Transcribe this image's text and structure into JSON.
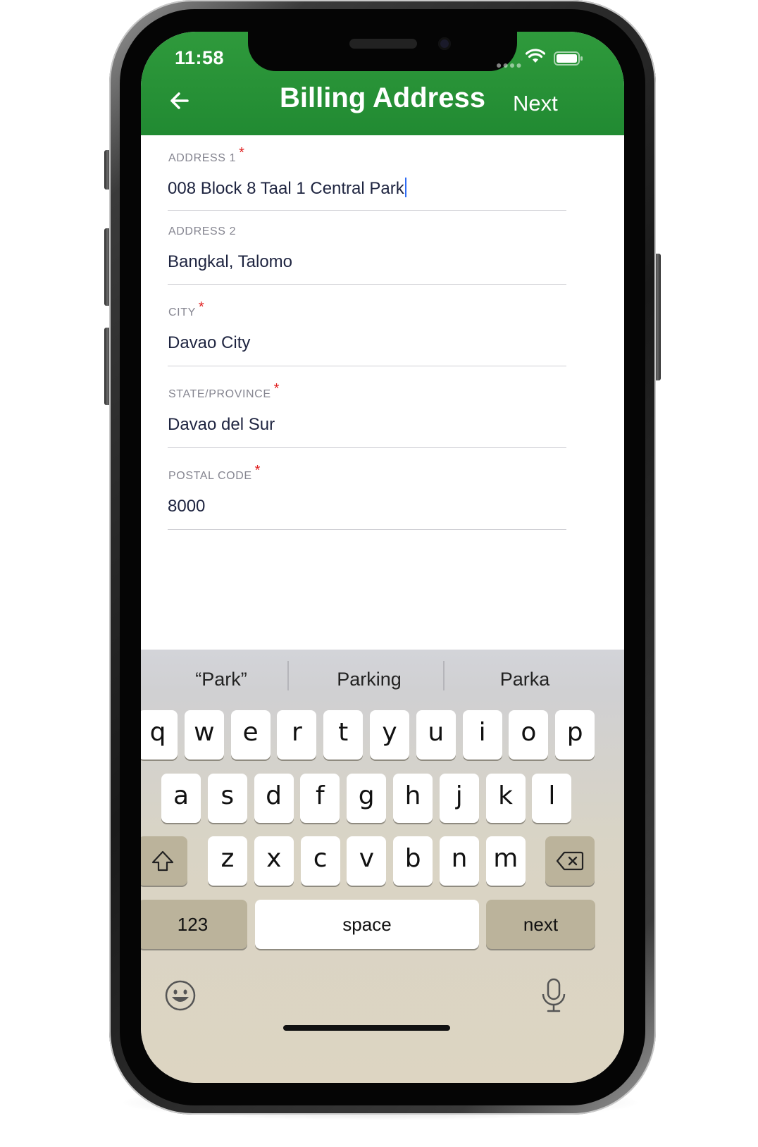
{
  "status_bar": {
    "time": "11:58"
  },
  "header": {
    "title": "Billing Address",
    "next_label": "Next",
    "background": "#2a9238"
  },
  "form": {
    "fields": [
      {
        "label": "ADDRESS 1",
        "required": "*",
        "value": "008 Block 8 Taal 1 Central Park",
        "focused": true
      },
      {
        "label": "ADDRESS 2",
        "required": "",
        "value": "Bangkal, Talomo",
        "focused": false
      },
      {
        "label": "CITY",
        "required": "*",
        "value": "Davao City",
        "focused": false
      },
      {
        "label": "STATE/PROVINCE",
        "required": "*",
        "value": "Davao del Sur",
        "focused": false
      },
      {
        "label": "POSTAL CODE",
        "required": "*",
        "value": "8000",
        "focused": false
      }
    ]
  },
  "keyboard": {
    "suggestions": [
      "“Park”",
      "Parking",
      "Parka"
    ],
    "row1": [
      "q",
      "w",
      "e",
      "r",
      "t",
      "y",
      "u",
      "i",
      "o",
      "p"
    ],
    "row2": [
      "a",
      "s",
      "d",
      "f",
      "g",
      "h",
      "j",
      "k",
      "l"
    ],
    "row3": [
      "z",
      "x",
      "c",
      "v",
      "b",
      "n",
      "m"
    ],
    "numbers_label": "123",
    "space_label": "space",
    "return_label": "next",
    "icons": [
      "shift-icon",
      "backspace-icon",
      "emoji-icon",
      "microphone-icon"
    ]
  },
  "colors": {
    "required": "#e02020",
    "caret": "#2f6cf5",
    "text": "#1e2440"
  }
}
